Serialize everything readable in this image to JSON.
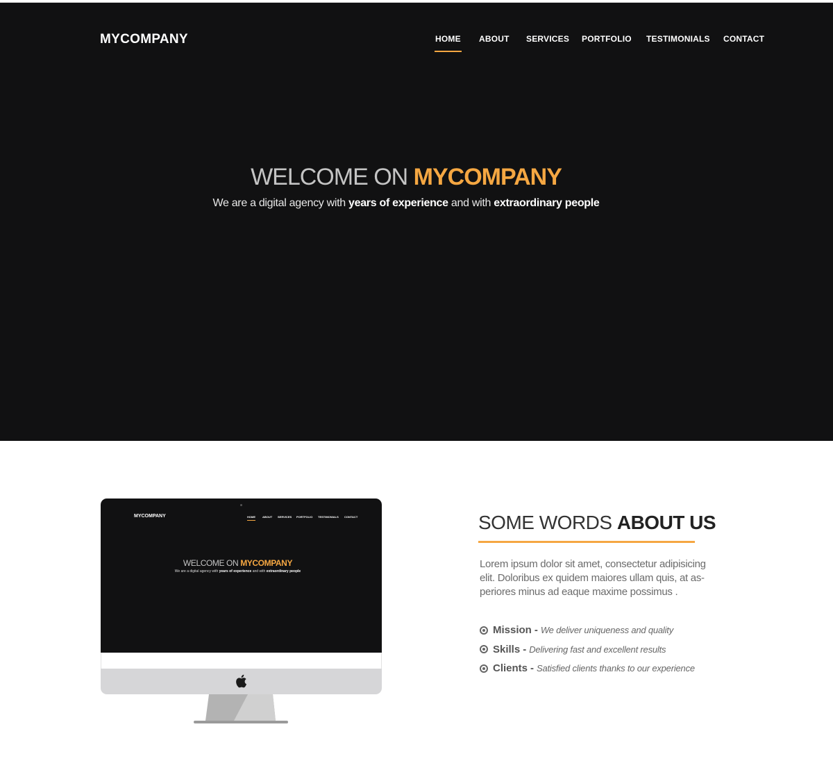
{
  "header": {
    "brand": "MYCOMPANY",
    "nav": [
      {
        "label": "HOME",
        "active": true
      },
      {
        "label": "ABOUT",
        "active": false
      },
      {
        "label": "SERVICES",
        "active": false
      },
      {
        "label": "PORTFOLIO",
        "active": false
      },
      {
        "label": "TESTIMONIALS",
        "active": false
      },
      {
        "label": "CONTACT",
        "active": false
      }
    ]
  },
  "hero": {
    "title_prefix": "WELCOME ON ",
    "title_highlight": "MYCOMPANY",
    "subtitle_1": "We are a digital agency with ",
    "subtitle_bold_1": "years of experience",
    "subtitle_2": " and with ",
    "subtitle_bold_2": "extraordinary people"
  },
  "monitor": {
    "apple_icon": "apple-logo-icon"
  },
  "about": {
    "title_prefix": "SOME WORDS ",
    "title_bold": "ABOUT US",
    "text": "Lorem ipsum dolor sit amet, consectetur adipisicing elit. Doloribus ex quidem maiores ullam quis, at as-periores minus ad eaque maxime possimus .",
    "text_line_1": "Lorem ipsum dolor sit amet, consectetur adipisicing",
    "text_line_2": "elit. Doloribus ex quidem maiores ullam quis, at as-",
    "text_line_3": "periores minus ad eaque maxime possimus .",
    "features": [
      {
        "name": "Mission",
        "separator": "-",
        "desc": "We deliver uniqueness and quality",
        "icon": "bullseye-icon"
      },
      {
        "name": "Skills",
        "separator": "-",
        "desc": "Delivering fast and excellent results",
        "icon": "bullseye-icon"
      },
      {
        "name": "Clients",
        "separator": "-",
        "desc": "Satisfied clients thanks to our experience",
        "icon": "bullseye-icon"
      }
    ]
  },
  "colors": {
    "accent": "#f5a742",
    "hero_bg": "#111112",
    "page_bg": "#ffffff"
  }
}
